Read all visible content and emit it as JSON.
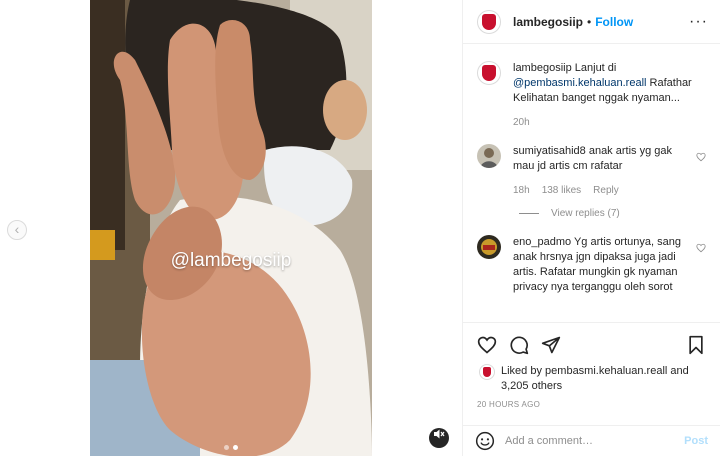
{
  "colors": {
    "link": "#0095f6",
    "mention": "#00376b",
    "muted": "#8e8e8e",
    "post_disabled": "#b2dffc",
    "brand_red": "#c8102e"
  },
  "media": {
    "watermark": "@lambegosiip",
    "carousel_dots": 2,
    "active_dot": 2,
    "icons": {
      "prev": "chevron-left-icon",
      "mute": "speaker-muted-icon"
    }
  },
  "header": {
    "username": "lambegosiip",
    "separator": "•",
    "follow_label": "Follow",
    "more_icon": "more-options-icon"
  },
  "caption": {
    "username": "lambegosiip",
    "text_before": "Lanjut di",
    "mention": "@pembasmi.kehaluan.reall",
    "text_after": "Rafathar Kelihatan banget nggak nyaman...",
    "time": "20h"
  },
  "comments": [
    {
      "username": "sumiyatisahid8",
      "text": "anak artis yg gak mau jd artis cm rafatar",
      "time": "18h",
      "likes": "138 likes",
      "reply_label": "Reply",
      "view_replies": "View replies (7)"
    },
    {
      "username": "eno_padmo",
      "text": "Yg artis ortunya, sang anak hrsnya jgn dipaksa juga jadi artis. Rafatar mungkin gk nyaman privacy nya terganggu oleh sorot"
    }
  ],
  "actions": {
    "icons": [
      "heart-icon",
      "comment-icon",
      "share-icon",
      "bookmark-icon"
    ]
  },
  "likes": {
    "prefix": "Liked by",
    "user": "pembasmi.kehaluan.reall",
    "and": "and",
    "others": "3,205 others"
  },
  "timestamp": "20 HOURS AGO",
  "add_comment": {
    "placeholder": "Add a comment…",
    "post_label": "Post"
  }
}
